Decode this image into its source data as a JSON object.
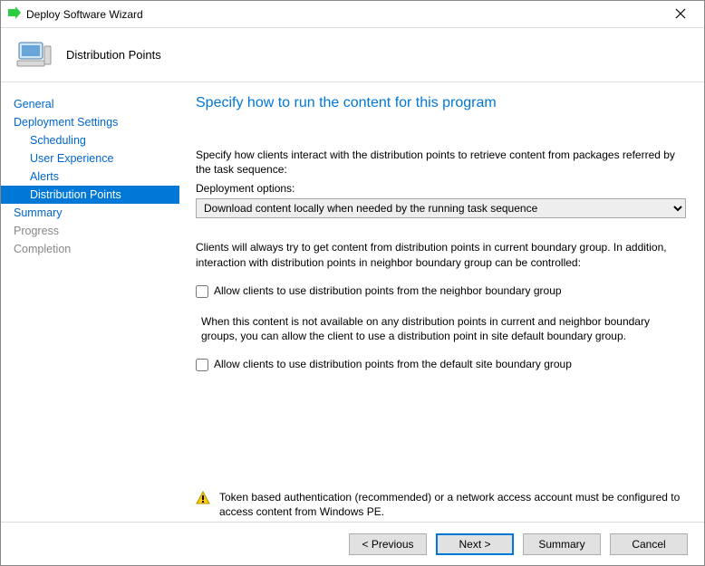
{
  "window": {
    "title": "Deploy Software Wizard",
    "subtitle": "Distribution Points"
  },
  "sidebar": {
    "items": [
      {
        "label": "General",
        "kind": "link"
      },
      {
        "label": "Deployment Settings",
        "kind": "link"
      },
      {
        "label": "Scheduling",
        "kind": "sub link"
      },
      {
        "label": "User Experience",
        "kind": "sub link"
      },
      {
        "label": "Alerts",
        "kind": "sub link"
      },
      {
        "label": "Distribution Points",
        "kind": "sub selected"
      },
      {
        "label": "Summary",
        "kind": "link"
      },
      {
        "label": "Progress",
        "kind": "disabled"
      },
      {
        "label": "Completion",
        "kind": "disabled"
      }
    ]
  },
  "content": {
    "heading": "Specify how to run the content for this program",
    "intro": "Specify how clients interact with the distribution points to retrieve content from packages referred by the task sequence:",
    "options_label": "Deployment options:",
    "selected_option": "Download content locally when needed by the running task sequence",
    "boundary_text": "Clients will always try to get content from distribution points in current boundary group. In addition, interaction with distribution points in neighbor boundary group can be controlled:",
    "chk1_label": "Allow clients to use distribution points from the neighbor boundary group",
    "chk1_checked": false,
    "fallback_text": "When this content is not available on any distribution points in current and neighbor boundary groups, you can allow the client to use a distribution point in site default boundary group.",
    "chk2_label": "Allow clients to use distribution points from the default site boundary group",
    "chk2_checked": false,
    "warning": "Token based authentication (recommended) or a network access account must be configured to access content from Windows PE."
  },
  "footer": {
    "previous": "< Previous",
    "next": "Next >",
    "summary": "Summary",
    "cancel": "Cancel"
  }
}
